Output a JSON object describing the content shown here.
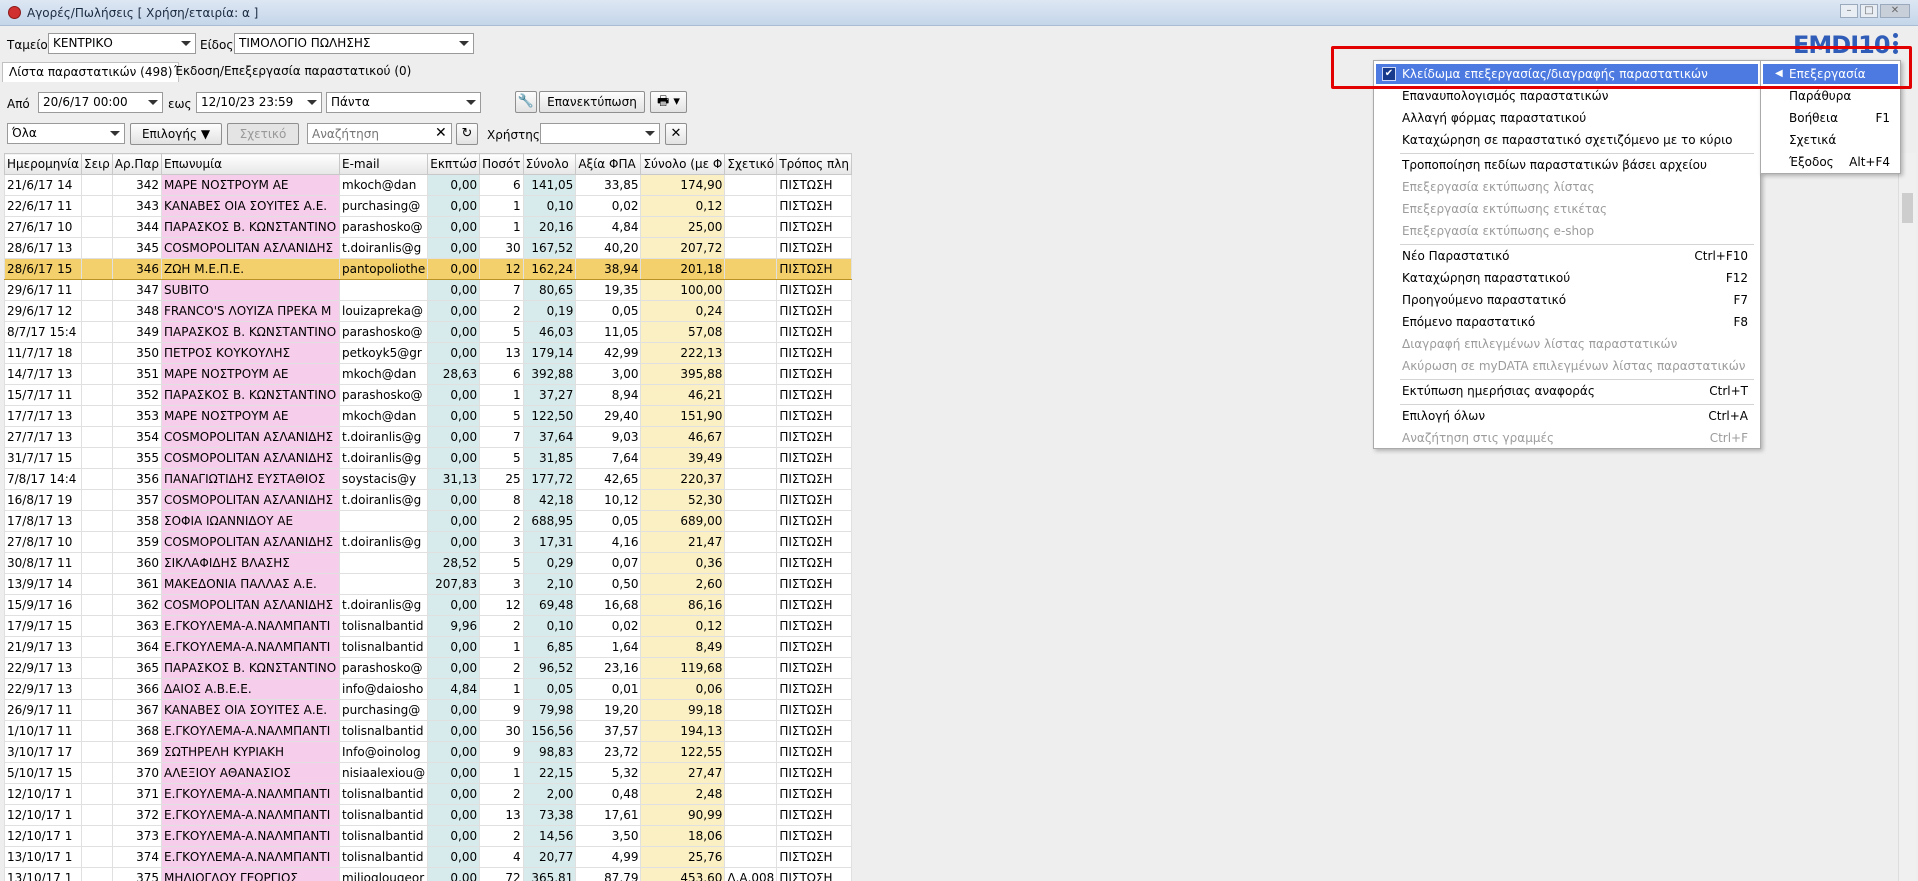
{
  "window": {
    "title": "Αγορές/Πωλήσεις  [ Χρήση/εταιρία: α ]"
  },
  "filters": {
    "tameio_label": "Ταμείο",
    "tameio_value": "ΚΕΝΤΡΙΚΟ",
    "eidos_label": "Είδος",
    "eidos_value": "ΤΙΜΟΛΟΓΙΟ ΠΩΛΗΣΗΣ",
    "from_label": "Από",
    "from_value": "20/6/17 00:00",
    "to_label": "εως",
    "to_value": "12/10/23 23:59",
    "period_value": "Πάντα",
    "reprint_label": "Επανεκτύπωση",
    "all_value": "Όλα",
    "choices_label": "Επιλογής",
    "related_label": "Σχετικό",
    "search_placeholder": "Αναζήτηση",
    "user_label": "Χρήστης"
  },
  "tabs": [
    {
      "label": "Λίστα παραστατικών (498)"
    },
    {
      "label": "Έκδοση/Επεξεργασία παραστατικού (0)"
    }
  ],
  "logo": "EMDI10",
  "columns": [
    "Ημερομηνία",
    "Σειρ",
    "Αρ.Παρ",
    "Επωνυμία",
    "E-mail",
    "Εκπτώσ",
    "Ποσότ",
    "Σύνολο",
    "Αξία ΦΠΑ",
    "Σύνολο (με Φ",
    "Σχετικό",
    "Τρόπος πλη"
  ],
  "rows": [
    [
      "21/6/17 14",
      "",
      "342",
      "ΜΑΡΕ ΝΟΣΤΡΟΥΜ ΑΕ",
      "mkoch@dan",
      "0,00",
      "6",
      "141,05",
      "33,85",
      "174,90",
      "",
      "ΠΙΣΤΩΣΗ"
    ],
    [
      "22/6/17 11",
      "",
      "343",
      "ΚΑΝΑΒΕΣ ΟΙΑ ΣΟΥΙΤΕΣ Α.Ε.",
      "purchasing@",
      "0,00",
      "1",
      "0,10",
      "0,02",
      "0,12",
      "",
      "ΠΙΣΤΩΣΗ"
    ],
    [
      "27/6/17 10",
      "",
      "344",
      "ΠΑΡΑΣΚΟΣ Β. ΚΩΝΣΤΑΝΤΙΝΟ",
      "parashosko@",
      "0,00",
      "1",
      "20,16",
      "4,84",
      "25,00",
      "",
      "ΠΙΣΤΩΣΗ"
    ],
    [
      "28/6/17 13",
      "",
      "345",
      "COSMOPOLITAN ΑΣΛΑΝΙΔΗΣ",
      "t.doiranlis@g",
      "0,00",
      "30",
      "167,52",
      "40,20",
      "207,72",
      "",
      "ΠΙΣΤΩΣΗ"
    ],
    [
      "28/6/17 15",
      "",
      "346",
      "ΖΩΗ Μ.Ε.Π.Ε.",
      "pantopoliothe",
      "0,00",
      "12",
      "162,24",
      "38,94",
      "201,18",
      "",
      "ΠΙΣΤΩΣΗ"
    ],
    [
      "29/6/17 11",
      "",
      "347",
      "SUBITO",
      "",
      "0,00",
      "7",
      "80,65",
      "19,35",
      "100,00",
      "",
      "ΠΙΣΤΩΣΗ"
    ],
    [
      "29/6/17 12",
      "",
      "348",
      "FRANCO'S ΛΟΥΙΖΑ ΠΡΕΚΑ Μ",
      "louizapreka@",
      "0,00",
      "2",
      "0,19",
      "0,05",
      "0,24",
      "",
      "ΠΙΣΤΩΣΗ"
    ],
    [
      "8/7/17 15:4",
      "",
      "349",
      "ΠΑΡΑΣΚΟΣ Β. ΚΩΝΣΤΑΝΤΙΝΟ",
      "parashosko@",
      "0,00",
      "5",
      "46,03",
      "11,05",
      "57,08",
      "",
      "ΠΙΣΤΩΣΗ"
    ],
    [
      "11/7/17 18",
      "",
      "350",
      "ΠΕΤΡΟΣ ΚΟΥΚΟΥΛΗΣ",
      "petkoyk5@gr",
      "0,00",
      "13",
      "179,14",
      "42,99",
      "222,13",
      "",
      "ΠΙΣΤΩΣΗ"
    ],
    [
      "14/7/17 13",
      "",
      "351",
      "ΜΑΡΕ ΝΟΣΤΡΟΥΜ ΑΕ",
      "mkoch@dan",
      "28,63",
      "6",
      "392,88",
      "3,00",
      "395,88",
      "",
      "ΠΙΣΤΩΣΗ"
    ],
    [
      "15/7/17 11",
      "",
      "352",
      "ΠΑΡΑΣΚΟΣ Β. ΚΩΝΣΤΑΝΤΙΝΟ",
      "parashosko@",
      "0,00",
      "1",
      "37,27",
      "8,94",
      "46,21",
      "",
      "ΠΙΣΤΩΣΗ"
    ],
    [
      "17/7/17 13",
      "",
      "353",
      "ΜΑΡΕ ΝΟΣΤΡΟΥΜ ΑΕ",
      "mkoch@dan",
      "0,00",
      "5",
      "122,50",
      "29,40",
      "151,90",
      "",
      "ΠΙΣΤΩΣΗ"
    ],
    [
      "27/7/17 13",
      "",
      "354",
      "COSMOPOLITAN ΑΣΛΑΝΙΔΗΣ",
      "t.doiranlis@g",
      "0,00",
      "7",
      "37,64",
      "9,03",
      "46,67",
      "",
      "ΠΙΣΤΩΣΗ"
    ],
    [
      "31/7/17 15",
      "",
      "355",
      "COSMOPOLITAN ΑΣΛΑΝΙΔΗΣ",
      "t.doiranlis@g",
      "0,00",
      "5",
      "31,85",
      "7,64",
      "39,49",
      "",
      "ΠΙΣΤΩΣΗ"
    ],
    [
      "7/8/17 14:4",
      "",
      "356",
      "ΠΑΝΑΓΙΩΤΙΔΗΣ ΕΥΣΤΑΘΙΟΣ",
      "soystacis@y",
      "31,13",
      "25",
      "177,72",
      "42,65",
      "220,37",
      "",
      "ΠΙΣΤΩΣΗ"
    ],
    [
      "16/8/17 19",
      "",
      "357",
      "COSMOPOLITAN ΑΣΛΑΝΙΔΗΣ",
      "t.doiranlis@g",
      "0,00",
      "8",
      "42,18",
      "10,12",
      "52,30",
      "",
      "ΠΙΣΤΩΣΗ"
    ],
    [
      "17/8/17 13",
      "",
      "358",
      "ΣΟΦΙΑ ΙΩΑΝΝΙΔΟΥ ΑΕ",
      "",
      "0,00",
      "2",
      "688,95",
      "0,05",
      "689,00",
      "",
      "ΠΙΣΤΩΣΗ"
    ],
    [
      "27/8/17 10",
      "",
      "359",
      "COSMOPOLITAN ΑΣΛΑΝΙΔΗΣ",
      "t.doiranlis@g",
      "0,00",
      "3",
      "17,31",
      "4,16",
      "21,47",
      "",
      "ΠΙΣΤΩΣΗ"
    ],
    [
      "30/8/17 11",
      "",
      "360",
      "ΣΙΚΛΑΦΙΔΗΣ ΒΛΑΣΗΣ",
      "",
      "28,52",
      "5",
      "0,29",
      "0,07",
      "0,36",
      "",
      "ΠΙΣΤΩΣΗ"
    ],
    [
      "13/9/17 14",
      "",
      "361",
      "ΜΑΚΕΔΟΝΙΑ ΠΑΛΛΑΣ Α.Ε.",
      "",
      "207,83",
      "3",
      "2,10",
      "0,50",
      "2,60",
      "",
      "ΠΙΣΤΩΣΗ"
    ],
    [
      "15/9/17 16",
      "",
      "362",
      "COSMOPOLITAN ΑΣΛΑΝΙΔΗΣ",
      "t.doiranlis@g",
      "0,00",
      "12",
      "69,48",
      "16,68",
      "86,16",
      "",
      "ΠΙΣΤΩΣΗ"
    ],
    [
      "17/9/17 15",
      "",
      "363",
      "Ε.ΓΚΟΥΛΕΜΑ-Α.ΝΑΛΜΠΑΝΤΙ",
      "tolisnalbantid",
      "9,96",
      "2",
      "0,10",
      "0,02",
      "0,12",
      "",
      "ΠΙΣΤΩΣΗ"
    ],
    [
      "21/9/17 13",
      "",
      "364",
      "Ε.ΓΚΟΥΛΕΜΑ-Α.ΝΑΛΜΠΑΝΤΙ",
      "tolisnalbantid",
      "0,00",
      "1",
      "6,85",
      "1,64",
      "8,49",
      "",
      "ΠΙΣΤΩΣΗ"
    ],
    [
      "22/9/17 13",
      "",
      "365",
      "ΠΑΡΑΣΚΟΣ Β. ΚΩΝΣΤΑΝΤΙΝΟ",
      "parashosko@",
      "0,00",
      "2",
      "96,52",
      "23,16",
      "119,68",
      "",
      "ΠΙΣΤΩΣΗ"
    ],
    [
      "22/9/17 13",
      "",
      "366",
      "ΔΑΙΟΣ Α.Β.Ε.Ε.",
      "info@daiosho",
      "4,84",
      "1",
      "0,05",
      "0,01",
      "0,06",
      "",
      "ΠΙΣΤΩΣΗ"
    ],
    [
      "26/9/17 11",
      "",
      "367",
      "ΚΑΝΑΒΕΣ ΟΙΑ ΣΟΥΙΤΕΣ Α.Ε.",
      "purchasing@",
      "0,00",
      "9",
      "79,98",
      "19,20",
      "99,18",
      "",
      "ΠΙΣΤΩΣΗ"
    ],
    [
      "1/10/17 11",
      "",
      "368",
      "Ε.ΓΚΟΥΛΕΜΑ-Α.ΝΑΛΜΠΑΝΤΙ",
      "tolisnalbantid",
      "0,00",
      "30",
      "156,56",
      "37,57",
      "194,13",
      "",
      "ΠΙΣΤΩΣΗ"
    ],
    [
      "3/10/17 17",
      "",
      "369",
      "ΣΩΤΗΡΕΛΗ ΚΥΡΙΑΚΗ",
      "Info@oinolog",
      "0,00",
      "9",
      "98,83",
      "23,72",
      "122,55",
      "",
      "ΠΙΣΤΩΣΗ"
    ],
    [
      "5/10/17 15",
      "",
      "370",
      "ΑΛΕΞΙΟΥ ΑΘΑΝΑΣΙΟΣ",
      "nisiaalexiou@",
      "0,00",
      "1",
      "22,15",
      "5,32",
      "27,47",
      "",
      "ΠΙΣΤΩΣΗ"
    ],
    [
      "12/10/17 1",
      "",
      "371",
      "Ε.ΓΚΟΥΛΕΜΑ-Α.ΝΑΛΜΠΑΝΤΙ",
      "tolisnalbantid",
      "0,00",
      "2",
      "2,00",
      "0,48",
      "2,48",
      "",
      "ΠΙΣΤΩΣΗ"
    ],
    [
      "12/10/17 1",
      "",
      "372",
      "Ε.ΓΚΟΥΛΕΜΑ-Α.ΝΑΛΜΠΑΝΤΙ",
      "tolisnalbantid",
      "0,00",
      "13",
      "73,38",
      "17,61",
      "90,99",
      "",
      "ΠΙΣΤΩΣΗ"
    ],
    [
      "12/10/17 1",
      "",
      "373",
      "Ε.ΓΚΟΥΛΕΜΑ-Α.ΝΑΛΜΠΑΝΤΙ",
      "tolisnalbantid",
      "0,00",
      "2",
      "14,56",
      "3,50",
      "18,06",
      "",
      "ΠΙΣΤΩΣΗ"
    ],
    [
      "13/10/17 1",
      "",
      "374",
      "Ε.ΓΚΟΥΛΕΜΑ-Α.ΝΑΛΜΠΑΝΤΙ",
      "tolisnalbantid",
      "0,00",
      "4",
      "20,77",
      "4,99",
      "25,76",
      "",
      "ΠΙΣΤΩΣΗ"
    ],
    [
      "13/10/17 1",
      "",
      "375",
      "ΜΗΛΙΟΓΛΟΥ ΓΕΩΡΓΙΟΣ",
      "milioglougeor",
      "0,00",
      "72",
      "365,81",
      "87,79",
      "453,60",
      "Δ.Α.008",
      "ΠΙΣΤΩΣΗ"
    ]
  ],
  "selected_row_index": 4,
  "context_menu": {
    "items": [
      {
        "label": "Κλείδωμα επεξεργασίας/διαγραφής παραστατικών",
        "shortcut": "",
        "checked": true,
        "highlighted": true,
        "disabled": false
      },
      {
        "label": "Επαναυπολογισμός παραστατικών",
        "shortcut": "",
        "disabled": false
      },
      {
        "label": "Αλλαγή φόρμας παραστατικού",
        "shortcut": "",
        "disabled": false
      },
      {
        "label": "Καταχώρηση σε παραστατικό σχετιζόμενο με το κύριο",
        "shortcut": "",
        "disabled": false,
        "sep_after": true
      },
      {
        "label": "Τροποποίηση πεδίων παραστατικών βάσει αρχείου",
        "shortcut": "",
        "disabled": false
      },
      {
        "label": "Επεξεργασία εκτύπωσης λίστας",
        "shortcut": "",
        "disabled": true
      },
      {
        "label": "Επεξεργασία εκτύπωσης ετικέτας",
        "shortcut": "",
        "disabled": true
      },
      {
        "label": "Επεξεργασία εκτύπωσης e-shop",
        "shortcut": "",
        "disabled": true,
        "sep_after": true
      },
      {
        "label": "Νέο Παραστατικό",
        "shortcut": "Ctrl+F10",
        "disabled": false
      },
      {
        "label": "Καταχώρηση παραστατικού",
        "shortcut": "F12",
        "disabled": false
      },
      {
        "label": "Προηγούμενο παραστατικό",
        "shortcut": "F7",
        "disabled": false
      },
      {
        "label": "Επόμενο παραστατικό",
        "shortcut": "F8",
        "disabled": false
      },
      {
        "label": "Διαγραφή επιλεγμένων λίστας παραστατικών",
        "shortcut": "",
        "disabled": true
      },
      {
        "label": "Ακύρωση σε myDATA επιλεγμένων λίστας παραστατικών",
        "shortcut": "",
        "disabled": true,
        "sep_after": true
      },
      {
        "label": "Εκτύπωση ημερήσιας αναφοράς",
        "shortcut": "Ctrl+T",
        "disabled": false,
        "sep_after": true
      },
      {
        "label": "Επιλογή όλων",
        "shortcut": "Ctrl+A",
        "disabled": false
      },
      {
        "label": "Αναζήτηση στις γραμμές",
        "shortcut": "Ctrl+F",
        "disabled": true
      }
    ]
  },
  "side_menu": {
    "items": [
      {
        "label": "Επεξεργασία",
        "shortcut": "",
        "highlighted": true
      },
      {
        "label": "Παράθυρα",
        "shortcut": ""
      },
      {
        "label": "Βοήθεια",
        "shortcut": "F1"
      },
      {
        "label": "Σχετικά",
        "shortcut": ""
      },
      {
        "label": "Έξοδος",
        "shortcut": "Alt+F4"
      }
    ]
  }
}
